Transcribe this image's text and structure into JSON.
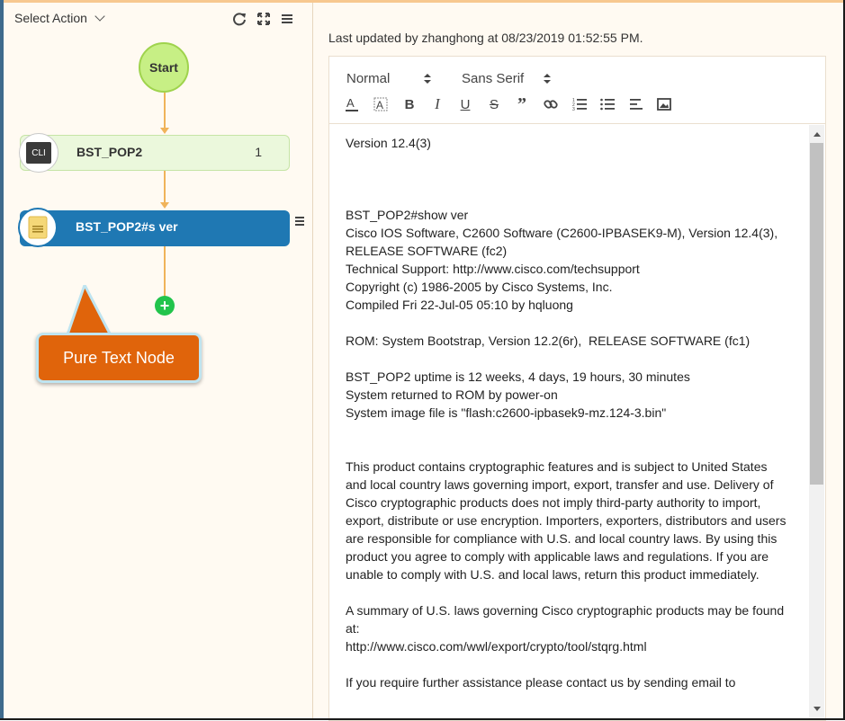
{
  "left_panel": {
    "select_action": "Select Action",
    "toolbar_icons": [
      "refresh-icon",
      "expand-icon",
      "menu-icon"
    ],
    "start_label": "Start",
    "nodes": [
      {
        "badge": "CLI",
        "label": "BST_POP2",
        "count": "1"
      },
      {
        "badge_icon": "document-icon",
        "label": "BST_POP2#s ver"
      }
    ],
    "callout": "Pure Text Node"
  },
  "right_panel": {
    "last_updated": "Last updated by zhanghong at 08/23/2019 01:52:55 PM.",
    "toolbar": {
      "format": "Normal",
      "font": "Sans Serif",
      "buttons": [
        "font-color-icon",
        "background-color-icon",
        "bold-icon",
        "italic-icon",
        "underline-icon",
        "strike-icon",
        "blockquote-icon",
        "link-icon",
        "ordered-list-icon",
        "bullet-list-icon",
        "align-icon",
        "image-icon"
      ]
    },
    "content": "Version 12.4(3)\n\n\n\nBST_POP2#show ver\nCisco IOS Software, C2600 Software (C2600-IPBASEK9-M), Version 12.4(3), RELEASE SOFTWARE (fc2)\nTechnical Support: http://www.cisco.com/techsupport\nCopyright (c) 1986-2005 by Cisco Systems, Inc.\nCompiled Fri 22-Jul-05 05:10 by hqluong\n\nROM: System Bootstrap, Version 12.2(6r),  RELEASE SOFTWARE (fc1)\n\nBST_POP2 uptime is 12 weeks, 4 days, 19 hours, 30 minutes\nSystem returned to ROM by power-on\nSystem image file is \"flash:c2600-ipbasek9-mz.124-3.bin\"\n\n\nThis product contains cryptographic features and is subject to United States and local country laws governing import, export, transfer and use. Delivery of Cisco cryptographic products does not imply third-party authority to import, export, distribute or use encryption. Importers, exporters, distributors and users are responsible for compliance with U.S. and local country laws. By using this product you agree to comply with applicable laws and regulations. If you are unable to comply with U.S. and local laws, return this product immediately.\n\nA summary of U.S. laws governing Cisco cryptographic products may be found at:\nhttp://www.cisco.com/wwl/export/crypto/tool/stqrg.html\n\nIf you require further assistance please contact us by sending email to"
  },
  "colors": {
    "start_fill": "#c7ef85",
    "cli_node_fill": "#ebf8dc",
    "text_node_fill": "#1f78b3",
    "connector": "#f0b35a",
    "add_button": "#22c44c",
    "callout": "#e0640b",
    "panel_bg": "#fffaf2"
  }
}
